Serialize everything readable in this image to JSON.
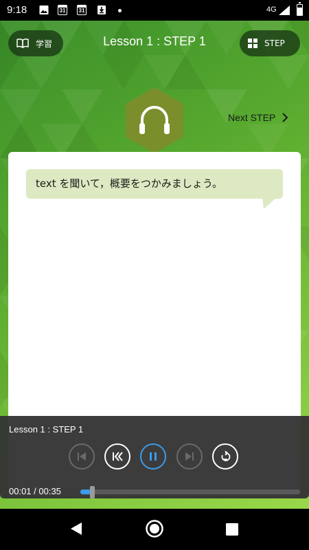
{
  "status_bar": {
    "time": "9:18",
    "calendar_day_1": "31",
    "calendar_day_2": "31",
    "network": "4G",
    "icons": [
      "image-icon",
      "calendar-icon",
      "calendar-icon",
      "download-icon",
      "notification-dot",
      "signal-icon",
      "battery-icon"
    ]
  },
  "header": {
    "learn_label": "学習",
    "title": "Lesson 1 : STEP 1",
    "step_label": "STEP"
  },
  "next_step_label": "Next STEP",
  "instruction": "text を聞いて，概要をつかみましょう。",
  "player": {
    "title": "Lesson 1 : STEP 1",
    "time": "00:01 / 00:35",
    "progress_fraction": 0.03
  },
  "colors": {
    "accent": "#3d9be9",
    "bubble": "#dde9c2",
    "hex": "#7a8f2c",
    "panel": "#343434"
  }
}
